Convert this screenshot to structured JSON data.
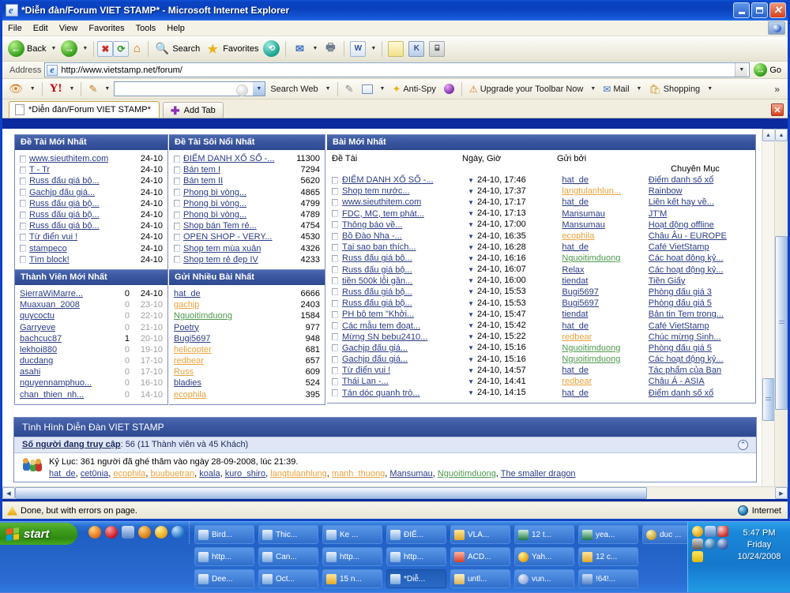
{
  "window": {
    "title": "*Diễn đàn/Forum VIET STAMP* - Microsoft Internet Explorer",
    "minimize": "_",
    "maximize": "□",
    "close": "✕"
  },
  "menu": {
    "items": [
      "File",
      "Edit",
      "View",
      "Favorites",
      "Tools",
      "Help"
    ]
  },
  "toolbar": {
    "back": "Back",
    "forward": "",
    "stop": "✖",
    "refresh": "⟳",
    "home": "⌂",
    "search": "Search",
    "favorites": "Favorites",
    "history": "",
    "mail": "",
    "print": "",
    "edit": "W",
    "discuss": "",
    "messenger": "",
    "research": ""
  },
  "address": {
    "label": "Address",
    "url": "http://www.vietstamp.net/forum/",
    "go": "Go"
  },
  "yahoo_toolbar": {
    "search_value": "",
    "search_web": "Search Web",
    "anti_spy": "Anti-Spy",
    "upgrade": "Upgrade your Toolbar Now",
    "mail": "Mail",
    "shopping": "Shopping",
    "overflow": "»"
  },
  "tabs": {
    "open": [
      {
        "label": "*Diễn đàn/Forum VIET STAMP*",
        "active": true
      }
    ],
    "add_tab": "Add Tab",
    "close_tab": "✕"
  },
  "forum": {
    "newest_topics": {
      "title": "Đề Tài Mới Nhất",
      "rows": [
        {
          "topic": "www.sieuthitem.com",
          "date": "24-10",
          "color": ""
        },
        {
          "topic": "T - Tr",
          "date": "24-10",
          "color": ""
        },
        {
          "topic": "Russ đấu giá bộ...",
          "date": "24-10",
          "color": ""
        },
        {
          "topic": "Gachjp đấu giá...",
          "date": "24-10",
          "color": ""
        },
        {
          "topic": "Russ đấu giá bộ...",
          "date": "24-10",
          "color": ""
        },
        {
          "topic": "Russ đấu giá bộ...",
          "date": "24-10",
          "color": ""
        },
        {
          "topic": "Russ đấu giá bộ...",
          "date": "24-10",
          "color": ""
        },
        {
          "topic": "Từ điển vui !",
          "date": "24-10",
          "color": ""
        },
        {
          "topic": "stampeco",
          "date": "24-10",
          "color": ""
        },
        {
          "topic": "Tìm block!",
          "date": "24-10",
          "color": ""
        }
      ]
    },
    "hottest_topics": {
      "title": "Đề Tài Sôi Nổi Nhất",
      "rows": [
        {
          "topic": "ĐIỂM DANH XỔ SỐ -...",
          "views": "11300"
        },
        {
          "topic": "Bán tem I",
          "views": "7294"
        },
        {
          "topic": "Bán tem II",
          "views": "5620"
        },
        {
          "topic": "Phong bì vòng...",
          "views": "4865"
        },
        {
          "topic": "Phong bì vòng...",
          "views": "4799"
        },
        {
          "topic": "Phong bì vòng...",
          "views": "4789"
        },
        {
          "topic": "Shop bán Tem rẻ...",
          "views": "4754"
        },
        {
          "topic": "OPEN SHOP - VERY...",
          "views": "4530"
        },
        {
          "topic": "Shop tem mùa xuân",
          "views": "4326"
        },
        {
          "topic": "Shop tem rẻ đẹp IV",
          "views": "4233"
        }
      ]
    },
    "newest_members": {
      "title": "Thành Viên Mới Nhất",
      "rows": [
        {
          "user": "SierraWiMarre...",
          "posts": "0",
          "date": "24-10",
          "active": true
        },
        {
          "user": "Muaxuan_2008",
          "posts": "0",
          "date": "23-10",
          "active": false
        },
        {
          "user": "quycoctu",
          "posts": "0",
          "date": "22-10",
          "active": false
        },
        {
          "user": "Garryeve",
          "posts": "0",
          "date": "21-10",
          "active": false
        },
        {
          "user": "bachcuc87",
          "posts": "1",
          "date": "20-10",
          "active": false
        },
        {
          "user": "lekhoi880",
          "posts": "0",
          "date": "19-10",
          "active": false
        },
        {
          "user": "ducdang",
          "posts": "0",
          "date": "17-10",
          "active": false
        },
        {
          "user": "asahi",
          "posts": "0",
          "date": "17-10",
          "active": false
        },
        {
          "user": "nguyennamphuo...",
          "posts": "0",
          "date": "16-10",
          "active": false
        },
        {
          "user": "chan_thien_nh...",
          "posts": "0",
          "date": "14-10",
          "active": false
        }
      ]
    },
    "top_posters": {
      "title": "Gửi Nhiều Bài Nhất",
      "rows": [
        {
          "user": "hat_de",
          "posts": "6666",
          "color": ""
        },
        {
          "user": "gachjp",
          "posts": "2403",
          "color": "o"
        },
        {
          "user": "Nguoitimduong",
          "posts": "1584",
          "color": "g"
        },
        {
          "user": "Poetry",
          "posts": "977",
          "color": ""
        },
        {
          "user": "Bugi5697",
          "posts": "948",
          "color": ""
        },
        {
          "user": "helicopter",
          "posts": "681",
          "color": "o"
        },
        {
          "user": "redbear",
          "posts": "657",
          "color": "o"
        },
        {
          "user": "Russ",
          "posts": "609",
          "color": "o"
        },
        {
          "user": "bladies",
          "posts": "524",
          "color": ""
        },
        {
          "user": "ecophila",
          "posts": "395",
          "color": "o"
        }
      ]
    },
    "latest_posts": {
      "title": "Bài Mới Nhất",
      "columns": [
        "Đề Tài",
        "Ngày, Giờ",
        "Gửi bởi",
        "Chuyên Mục"
      ],
      "rows": [
        {
          "topic": "ĐIỂM DANH XỔ SỐ -...",
          "datetime": "24-10, 17:46",
          "user": "hat_de",
          "user_color": "",
          "forum": "Điểm danh số xổ"
        },
        {
          "topic": "Shop tem nước...",
          "datetime": "24-10, 17:37",
          "user": "langtulanhlun...",
          "user_color": "o",
          "forum": "Rainbow"
        },
        {
          "topic": "www.sieuthitem.com",
          "datetime": "24-10, 17:17",
          "user": "hat_de",
          "user_color": "",
          "forum": "Liên kết hay về..."
        },
        {
          "topic": "FDC, MC, tem phát...",
          "datetime": "24-10, 17:13",
          "user": "Mansumau",
          "user_color": "",
          "forum": "JT'M"
        },
        {
          "topic": "Thông báo về...",
          "datetime": "24-10, 17:00",
          "user": "Mansumau",
          "user_color": "",
          "forum": "Hoạt động offline"
        },
        {
          "topic": "Bồ Đào Nha -...",
          "datetime": "24-10, 16:35",
          "user": "ecophila",
          "user_color": "o",
          "forum": "Châu Âu - EUROPE"
        },
        {
          "topic": "Tại sao bạn thích...",
          "datetime": "24-10, 16:28",
          "user": "hat_de",
          "user_color": "",
          "forum": "Café VietStamp"
        },
        {
          "topic": "Russ đấu giá bộ...",
          "datetime": "24-10, 16:16",
          "user": "Nguoitimduong",
          "user_color": "g",
          "forum": "Các hoạt động kỷ..."
        },
        {
          "topic": "Russ đấu giá bộ...",
          "datetime": "24-10, 16:07",
          "user": "Relax",
          "user_color": "",
          "forum": "Các hoạt động kỷ..."
        },
        {
          "topic": "tiền 500k lỗi gần...",
          "datetime": "24-10, 16:00",
          "user": "tiendat",
          "user_color": "",
          "forum": "Tiền Giấy"
        },
        {
          "topic": "Russ đấu giá bộ...",
          "datetime": "24-10, 15:53",
          "user": "Bugi5697",
          "user_color": "",
          "forum": "Phòng đấu giá 3"
        },
        {
          "topic": "Russ đấu giá bộ...",
          "datetime": "24-10, 15:53",
          "user": "Bugi5697",
          "user_color": "",
          "forum": "Phòng đấu giá 5"
        },
        {
          "topic": "PH bộ tem \"Khởi...",
          "datetime": "24-10, 15:47",
          "user": "tiendat",
          "user_color": "",
          "forum": "Bản tin Tem trong..."
        },
        {
          "topic": "Các mẫu tem đoạt...",
          "datetime": "24-10, 15:42",
          "user": "hat_de",
          "user_color": "",
          "forum": "Café VietStamp"
        },
        {
          "topic": "Mừng SN bebu2410...",
          "datetime": "24-10, 15:22",
          "user": "redbear",
          "user_color": "o",
          "forum": "Chúc mừng Sinh..."
        },
        {
          "topic": "Gachjp đấu giá...",
          "datetime": "24-10, 15:16",
          "user": "Nguoitimduong",
          "user_color": "g",
          "forum": "Phòng đấu giá 5"
        },
        {
          "topic": "Gachjp đấu giá...",
          "datetime": "24-10, 15:16",
          "user": "Nguoitimduong",
          "user_color": "g",
          "forum": "Các hoạt động kỷ..."
        },
        {
          "topic": "Từ điển vui !",
          "datetime": "24-10, 14:57",
          "user": "hat_de",
          "user_color": "",
          "forum": "Tác phẩm của Bạn"
        },
        {
          "topic": "Thái Lan -...",
          "datetime": "24-10, 14:41",
          "user": "redbear",
          "user_color": "o",
          "forum": "Châu Á - ASIA"
        },
        {
          "topic": "Tán dóc quanh trò...",
          "datetime": "24-10, 14:15",
          "user": "hat_de",
          "user_color": "",
          "forum": "Điểm danh số xổ"
        }
      ]
    },
    "stats": {
      "title": "Tình Hình Diễn Đàn VIET STAMP",
      "online_label": "Số người đang truy cập",
      "online_value": ": 56 (11 Thành viên và 45 Khách)",
      "record_line": "Kỷ Lục: 361 người đã ghé thăm vào ngày 28-09-2008, lúc 21:39.",
      "users_online": [
        {
          "name": "hat_de",
          "color": ""
        },
        {
          "name": "cet0nia",
          "color": ""
        },
        {
          "name": "ecophila",
          "color": "o"
        },
        {
          "name": "buubuetran",
          "color": "o"
        },
        {
          "name": "koala",
          "color": ""
        },
        {
          "name": "kuro_shiro",
          "color": ""
        },
        {
          "name": "langtulanhlung",
          "color": "o"
        },
        {
          "name": "manh_thuong",
          "color": "o"
        },
        {
          "name": "Mansumau",
          "color": ""
        },
        {
          "name": "Nguoitimduong",
          "color": "g"
        },
        {
          "name": "The smaller dragon",
          "color": ""
        }
      ]
    }
  },
  "statusbar": {
    "message": "Done, but with errors on page.",
    "zone": "Internet"
  },
  "taskbar": {
    "start": "start",
    "tasks": [
      {
        "label": "Bird...",
        "type": "ie",
        "active": false
      },
      {
        "label": "http...",
        "type": "ie",
        "active": false
      },
      {
        "label": "Dee...",
        "type": "ie",
        "active": false
      },
      {
        "label": "Thic...",
        "type": "ie",
        "active": false
      },
      {
        "label": "Can...",
        "type": "ie",
        "active": false
      },
      {
        "label": "Oct...",
        "type": "ie",
        "active": false
      },
      {
        "label": "Ke ...",
        "type": "ie",
        "active": false
      },
      {
        "label": "http...",
        "type": "ie",
        "active": false
      },
      {
        "label": "15 n...",
        "type": "folder",
        "active": false
      },
      {
        "label": "ĐIỂ...",
        "type": "ie",
        "active": false
      },
      {
        "label": "http...",
        "type": "ie",
        "active": false
      },
      {
        "label": "*Diễ...",
        "type": "ie",
        "active": true
      },
      {
        "label": "VLA...",
        "type": "folder",
        "active": false
      },
      {
        "label": "ACD...",
        "type": "photo",
        "active": false
      },
      {
        "label": "untl...",
        "type": "paint",
        "active": false
      },
      {
        "label": "12 t...",
        "type": "excel",
        "active": false
      },
      {
        "label": "Yah...",
        "type": "yahoo",
        "active": false
      },
      {
        "label": "vun...",
        "type": "disc",
        "active": false
      },
      {
        "label": "yea...",
        "type": "excel",
        "active": false
      },
      {
        "label": "12 c...",
        "type": "folder",
        "active": false
      },
      {
        "label": "!64!...",
        "type": "media",
        "active": false
      },
      {
        "label": "duc ...",
        "type": "disc",
        "active": false
      }
    ],
    "clock": {
      "time": "5:47 PM",
      "day": "Friday",
      "date": "10/24/2008"
    }
  }
}
